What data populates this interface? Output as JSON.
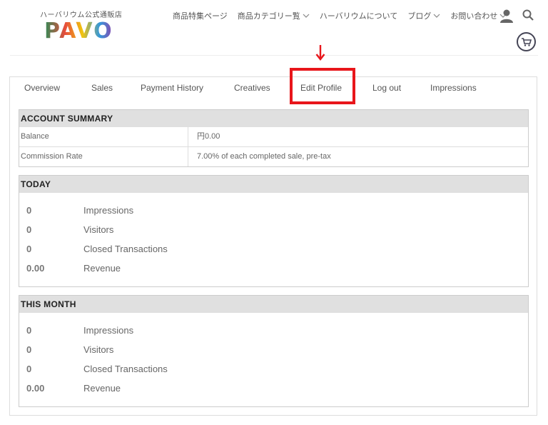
{
  "brand": {
    "tagline": "ハーバリウム公式通販店",
    "wordmark": "PAVO"
  },
  "topnav": [
    {
      "label": "商品特集ページ",
      "has_dropdown": false
    },
    {
      "label": "商品カテゴリー覧",
      "has_dropdown": true
    },
    {
      "label": "ハーバリウムについて",
      "has_dropdown": false
    },
    {
      "label": "ブログ",
      "has_dropdown": true
    },
    {
      "label": "お問い合わせ",
      "has_dropdown": true
    }
  ],
  "icons": {
    "user": "user-icon",
    "search": "search-icon",
    "cart": "cart-icon",
    "annotation_arrow": "down-arrow-icon"
  },
  "colors": {
    "highlight": "#e8161b",
    "section_header_bg": "#e0e0e0"
  },
  "tabs": [
    {
      "label": "Overview"
    },
    {
      "label": "Sales"
    },
    {
      "label": "Payment History"
    },
    {
      "label": "Creatives"
    },
    {
      "label": "Edit Profile",
      "highlighted": true
    },
    {
      "label": "Log out"
    },
    {
      "label": "Impressions"
    }
  ],
  "account_summary": {
    "title": "ACCOUNT SUMMARY",
    "rows": [
      {
        "label": "Balance",
        "value": "円0.00"
      },
      {
        "label": "Commission Rate",
        "value": "7.00% of each completed sale, pre-tax"
      }
    ]
  },
  "today": {
    "title": "TODAY",
    "rows": [
      {
        "value": "0",
        "label": "Impressions"
      },
      {
        "value": "0",
        "label": "Visitors"
      },
      {
        "value": "0",
        "label": "Closed Transactions"
      },
      {
        "value": "0.00",
        "label": "Revenue"
      }
    ]
  },
  "this_month": {
    "title": "THIS MONTH",
    "rows": [
      {
        "value": "0",
        "label": "Impressions"
      },
      {
        "value": "0",
        "label": "Visitors"
      },
      {
        "value": "0",
        "label": "Closed Transactions"
      },
      {
        "value": "0.00",
        "label": "Revenue"
      }
    ]
  }
}
